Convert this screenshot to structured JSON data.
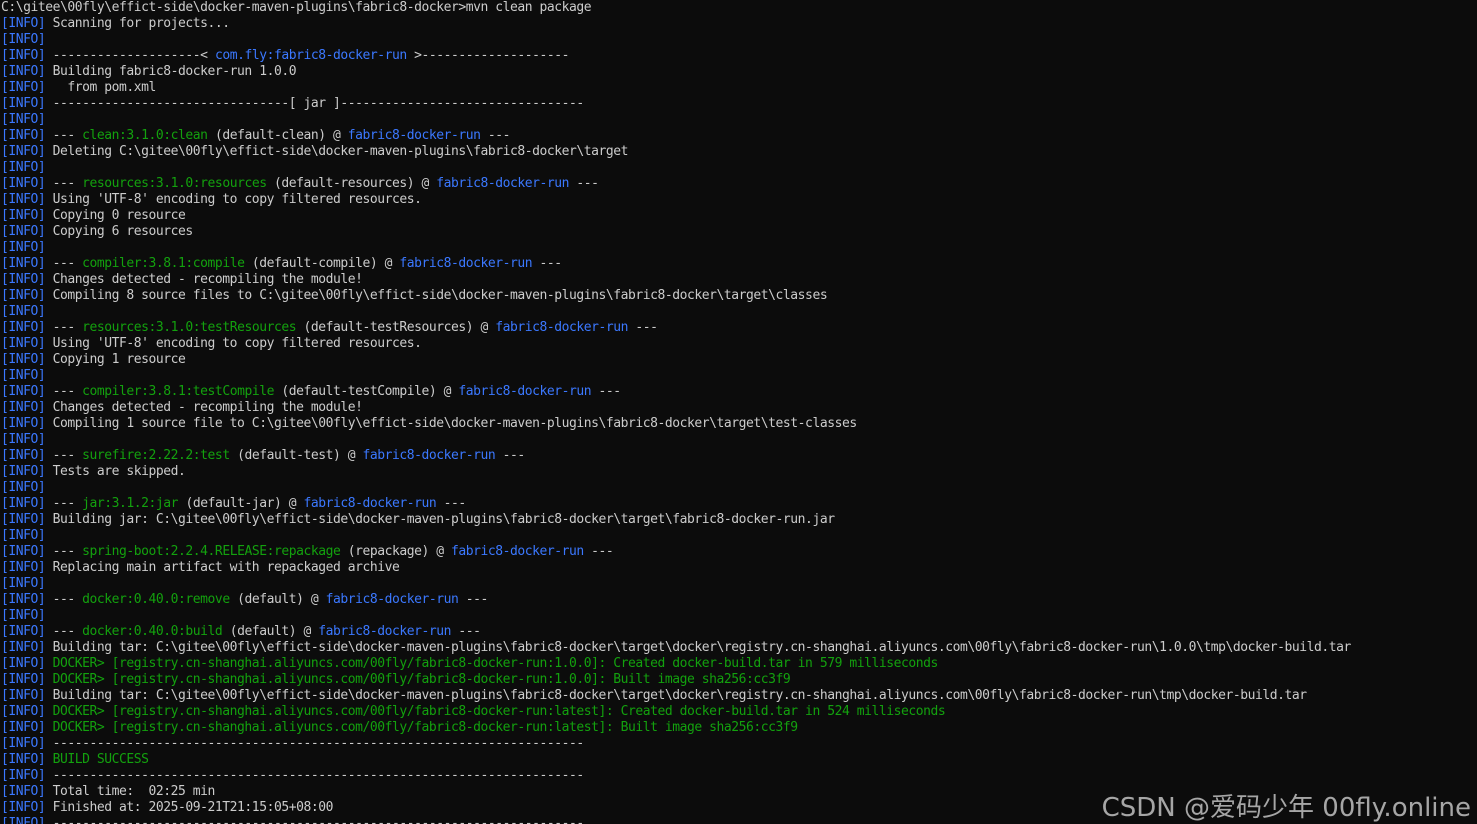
{
  "colors": {
    "background": "#0c0c0c",
    "text": "#cccccc",
    "info_tag": "#3b78ff",
    "plugin_name": "#13a10e",
    "artifact_name": "#3b78ff",
    "docker_output": "#13a10e"
  },
  "terminal": {
    "lines": [
      [
        {
          "t": "C:\\gitee\\00fly\\effict-side\\docker-maven-plugins\\fabric8-docker>mvn clean package",
          "c": "white"
        }
      ],
      [
        {
          "t": "[INFO]",
          "c": "info"
        },
        {
          "t": " Scanning for projects...",
          "c": "white"
        }
      ],
      [
        {
          "t": "[INFO]",
          "c": "info"
        }
      ],
      [
        {
          "t": "[INFO]",
          "c": "info"
        },
        {
          "t": " --------------------< ",
          "c": "white"
        },
        {
          "t": "com.fly:fabric8-docker-run",
          "c": "blue"
        },
        {
          "t": " >--------------------",
          "c": "white"
        }
      ],
      [
        {
          "t": "[INFO]",
          "c": "info"
        },
        {
          "t": " Building fabric8-docker-run 1.0.0",
          "c": "white"
        }
      ],
      [
        {
          "t": "[INFO]",
          "c": "info"
        },
        {
          "t": "   from pom.xml",
          "c": "white"
        }
      ],
      [
        {
          "t": "[INFO]",
          "c": "info"
        },
        {
          "t": " --------------------------------[ jar ]---------------------------------",
          "c": "white"
        }
      ],
      [
        {
          "t": "[INFO]",
          "c": "info"
        }
      ],
      [
        {
          "t": "[INFO]",
          "c": "info"
        },
        {
          "t": " --- ",
          "c": "white"
        },
        {
          "t": "clean:3.1.0:clean",
          "c": "green"
        },
        {
          "t": " (default-clean) @ ",
          "c": "white"
        },
        {
          "t": "fabric8-docker-run",
          "c": "blue"
        },
        {
          "t": " ---",
          "c": "white"
        }
      ],
      [
        {
          "t": "[INFO]",
          "c": "info"
        },
        {
          "t": " Deleting C:\\gitee\\00fly\\effict-side\\docker-maven-plugins\\fabric8-docker\\target",
          "c": "white"
        }
      ],
      [
        {
          "t": "[INFO]",
          "c": "info"
        }
      ],
      [
        {
          "t": "[INFO]",
          "c": "info"
        },
        {
          "t": " --- ",
          "c": "white"
        },
        {
          "t": "resources:3.1.0:resources",
          "c": "green"
        },
        {
          "t": " (default-resources) @ ",
          "c": "white"
        },
        {
          "t": "fabric8-docker-run",
          "c": "blue"
        },
        {
          "t": " ---",
          "c": "white"
        }
      ],
      [
        {
          "t": "[INFO]",
          "c": "info"
        },
        {
          "t": " Using 'UTF-8' encoding to copy filtered resources.",
          "c": "white"
        }
      ],
      [
        {
          "t": "[INFO]",
          "c": "info"
        },
        {
          "t": " Copying 0 resource",
          "c": "white"
        }
      ],
      [
        {
          "t": "[INFO]",
          "c": "info"
        },
        {
          "t": " Copying 6 resources",
          "c": "white"
        }
      ],
      [
        {
          "t": "[INFO]",
          "c": "info"
        }
      ],
      [
        {
          "t": "[INFO]",
          "c": "info"
        },
        {
          "t": " --- ",
          "c": "white"
        },
        {
          "t": "compiler:3.8.1:compile",
          "c": "green"
        },
        {
          "t": " (default-compile) @ ",
          "c": "white"
        },
        {
          "t": "fabric8-docker-run",
          "c": "blue"
        },
        {
          "t": " ---",
          "c": "white"
        }
      ],
      [
        {
          "t": "[INFO]",
          "c": "info"
        },
        {
          "t": " Changes detected - recompiling the module!",
          "c": "white"
        }
      ],
      [
        {
          "t": "[INFO]",
          "c": "info"
        },
        {
          "t": " Compiling 8 source files to C:\\gitee\\00fly\\effict-side\\docker-maven-plugins\\fabric8-docker\\target\\classes",
          "c": "white"
        }
      ],
      [
        {
          "t": "[INFO]",
          "c": "info"
        }
      ],
      [
        {
          "t": "[INFO]",
          "c": "info"
        },
        {
          "t": " --- ",
          "c": "white"
        },
        {
          "t": "resources:3.1.0:testResources",
          "c": "green"
        },
        {
          "t": " (default-testResources) @ ",
          "c": "white"
        },
        {
          "t": "fabric8-docker-run",
          "c": "blue"
        },
        {
          "t": " ---",
          "c": "white"
        }
      ],
      [
        {
          "t": "[INFO]",
          "c": "info"
        },
        {
          "t": " Using 'UTF-8' encoding to copy filtered resources.",
          "c": "white"
        }
      ],
      [
        {
          "t": "[INFO]",
          "c": "info"
        },
        {
          "t": " Copying 1 resource",
          "c": "white"
        }
      ],
      [
        {
          "t": "[INFO]",
          "c": "info"
        }
      ],
      [
        {
          "t": "[INFO]",
          "c": "info"
        },
        {
          "t": " --- ",
          "c": "white"
        },
        {
          "t": "compiler:3.8.1:testCompile",
          "c": "green"
        },
        {
          "t": " (default-testCompile) @ ",
          "c": "white"
        },
        {
          "t": "fabric8-docker-run",
          "c": "blue"
        },
        {
          "t": " ---",
          "c": "white"
        }
      ],
      [
        {
          "t": "[INFO]",
          "c": "info"
        },
        {
          "t": " Changes detected - recompiling the module!",
          "c": "white"
        }
      ],
      [
        {
          "t": "[INFO]",
          "c": "info"
        },
        {
          "t": " Compiling 1 source file to C:\\gitee\\00fly\\effict-side\\docker-maven-plugins\\fabric8-docker\\target\\test-classes",
          "c": "white"
        }
      ],
      [
        {
          "t": "[INFO]",
          "c": "info"
        }
      ],
      [
        {
          "t": "[INFO]",
          "c": "info"
        },
        {
          "t": " --- ",
          "c": "white"
        },
        {
          "t": "surefire:2.22.2:test",
          "c": "green"
        },
        {
          "t": " (default-test) @ ",
          "c": "white"
        },
        {
          "t": "fabric8-docker-run",
          "c": "blue"
        },
        {
          "t": " ---",
          "c": "white"
        }
      ],
      [
        {
          "t": "[INFO]",
          "c": "info"
        },
        {
          "t": " Tests are skipped.",
          "c": "white"
        }
      ],
      [
        {
          "t": "[INFO]",
          "c": "info"
        }
      ],
      [
        {
          "t": "[INFO]",
          "c": "info"
        },
        {
          "t": " --- ",
          "c": "white"
        },
        {
          "t": "jar:3.1.2:jar",
          "c": "green"
        },
        {
          "t": " (default-jar) @ ",
          "c": "white"
        },
        {
          "t": "fabric8-docker-run",
          "c": "blue"
        },
        {
          "t": " ---",
          "c": "white"
        }
      ],
      [
        {
          "t": "[INFO]",
          "c": "info"
        },
        {
          "t": " Building jar: C:\\gitee\\00fly\\effict-side\\docker-maven-plugins\\fabric8-docker\\target\\fabric8-docker-run.jar",
          "c": "white"
        }
      ],
      [
        {
          "t": "[INFO]",
          "c": "info"
        }
      ],
      [
        {
          "t": "[INFO]",
          "c": "info"
        },
        {
          "t": " --- ",
          "c": "white"
        },
        {
          "t": "spring-boot:2.2.4.RELEASE:repackage",
          "c": "green"
        },
        {
          "t": " (repackage) @ ",
          "c": "white"
        },
        {
          "t": "fabric8-docker-run",
          "c": "blue"
        },
        {
          "t": " ---",
          "c": "white"
        }
      ],
      [
        {
          "t": "[INFO]",
          "c": "info"
        },
        {
          "t": " Replacing main artifact with repackaged archive",
          "c": "white"
        }
      ],
      [
        {
          "t": "[INFO]",
          "c": "info"
        }
      ],
      [
        {
          "t": "[INFO]",
          "c": "info"
        },
        {
          "t": " --- ",
          "c": "white"
        },
        {
          "t": "docker:0.40.0:remove",
          "c": "green"
        },
        {
          "t": " (default) @ ",
          "c": "white"
        },
        {
          "t": "fabric8-docker-run",
          "c": "blue"
        },
        {
          "t": " ---",
          "c": "white"
        }
      ],
      [
        {
          "t": "[INFO]",
          "c": "info"
        }
      ],
      [
        {
          "t": "[INFO]",
          "c": "info"
        },
        {
          "t": " --- ",
          "c": "white"
        },
        {
          "t": "docker:0.40.0:build",
          "c": "green"
        },
        {
          "t": " (default) @ ",
          "c": "white"
        },
        {
          "t": "fabric8-docker-run",
          "c": "blue"
        },
        {
          "t": " ---",
          "c": "white"
        }
      ],
      [
        {
          "t": "[INFO]",
          "c": "info"
        },
        {
          "t": " Building tar: C:\\gitee\\00fly\\effict-side\\docker-maven-plugins\\fabric8-docker\\target\\docker\\registry.cn-shanghai.aliyuncs.com\\00fly\\fabric8-docker-run\\1.0.0\\tmp\\docker-build.tar",
          "c": "white"
        }
      ],
      [
        {
          "t": "[INFO]",
          "c": "info"
        },
        {
          "t": " DOCKER> [registry.cn-shanghai.aliyuncs.com/00fly/fabric8-docker-run:1.0.0]: Created docker-build.tar in 579 milliseconds",
          "c": "green"
        }
      ],
      [
        {
          "t": "[INFO]",
          "c": "info"
        },
        {
          "t": " DOCKER> [registry.cn-shanghai.aliyuncs.com/00fly/fabric8-docker-run:1.0.0]: Built image sha256:cc3f9",
          "c": "green"
        }
      ],
      [
        {
          "t": "[INFO]",
          "c": "info"
        },
        {
          "t": " Building tar: C:\\gitee\\00fly\\effict-side\\docker-maven-plugins\\fabric8-docker\\target\\docker\\registry.cn-shanghai.aliyuncs.com\\00fly\\fabric8-docker-run\\tmp\\docker-build.tar",
          "c": "white"
        }
      ],
      [
        {
          "t": "[INFO]",
          "c": "info"
        },
        {
          "t": " DOCKER> [registry.cn-shanghai.aliyuncs.com/00fly/fabric8-docker-run:latest]: Created docker-build.tar in 524 milliseconds",
          "c": "green"
        }
      ],
      [
        {
          "t": "[INFO]",
          "c": "info"
        },
        {
          "t": " DOCKER> [registry.cn-shanghai.aliyuncs.com/00fly/fabric8-docker-run:latest]: Built image sha256:cc3f9",
          "c": "green"
        }
      ],
      [
        {
          "t": "[INFO]",
          "c": "info"
        },
        {
          "t": " ------------------------------------------------------------------------",
          "c": "white"
        }
      ],
      [
        {
          "t": "[INFO]",
          "c": "info"
        },
        {
          "t": " BUILD SUCCESS",
          "c": "green"
        }
      ],
      [
        {
          "t": "[INFO]",
          "c": "info"
        },
        {
          "t": " ------------------------------------------------------------------------",
          "c": "white"
        }
      ],
      [
        {
          "t": "[INFO]",
          "c": "info"
        },
        {
          "t": " Total time:  02:25 min",
          "c": "white"
        }
      ],
      [
        {
          "t": "[INFO]",
          "c": "info"
        },
        {
          "t": " Finished at: 2025-09-21T21:15:05+08:00",
          "c": "white"
        }
      ],
      [
        {
          "t": "[INFO]",
          "c": "info"
        },
        {
          "t": " ------------------------------------------------------------------------",
          "c": "white"
        }
      ]
    ]
  },
  "watermark": {
    "text": "CSDN @爱码少年 00fly.online"
  }
}
